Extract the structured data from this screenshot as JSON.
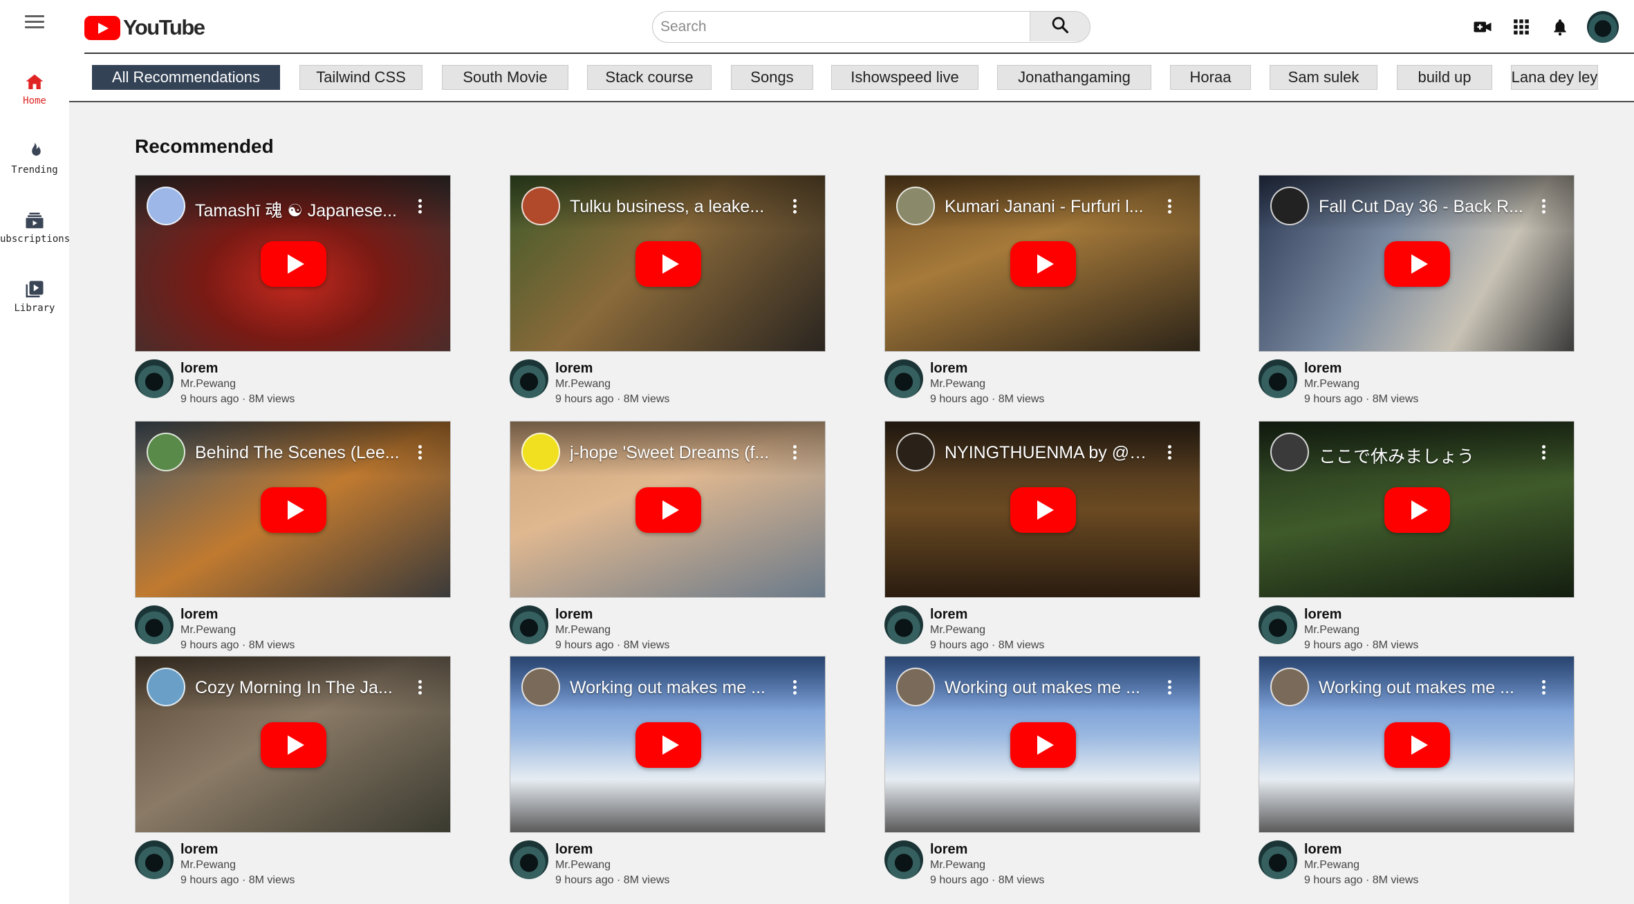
{
  "app": {
    "logo_text": "YouTube"
  },
  "search": {
    "placeholder": "Search",
    "value": ""
  },
  "sidebar": {
    "items": [
      {
        "label": "Home",
        "icon": "home-icon",
        "active": true
      },
      {
        "label": "Trending",
        "icon": "trending-icon",
        "active": false
      },
      {
        "label": "ubscriptions",
        "icon": "subscriptions-icon",
        "active": false
      },
      {
        "label": "Library",
        "icon": "library-icon",
        "active": false
      }
    ]
  },
  "chips": [
    "All Recommendations",
    "Tailwind CSS",
    "South Movie",
    "Stack course",
    "Songs",
    "Ishowspeed live",
    "Jonathangaming",
    "Horaa",
    "Sam sulek",
    "build up",
    "Lana dey ley"
  ],
  "main": {
    "section_title": "Recommended"
  },
  "videos": [
    {
      "overlay_title": "Tamashī 魂 ☯ Japanese...",
      "title": "lorem",
      "channel": "Mr.Pewang",
      "info": "9 hours ago · 8M views"
    },
    {
      "overlay_title": "Tulku business, a leake...",
      "title": "lorem",
      "channel": "Mr.Pewang",
      "info": "9 hours ago · 8M views"
    },
    {
      "overlay_title": "Kumari Janani - Furfuri l...",
      "title": "lorem",
      "channel": "Mr.Pewang",
      "info": "9 hours ago · 8M views"
    },
    {
      "overlay_title": "Fall Cut Day 36 - Back R...",
      "title": "lorem",
      "channel": "Mr.Pewang",
      "info": "9 hours ago · 8M views"
    },
    {
      "overlay_title": "Behind The Scenes (Lee...",
      "title": "lorem",
      "channel": "Mr.Pewang",
      "info": "9 hours ago · 8M views"
    },
    {
      "overlay_title": "j-hope 'Sweet Dreams (f...",
      "title": "lorem",
      "channel": "Mr.Pewang",
      "info": "9 hours ago · 8M views"
    },
    {
      "overlay_title": "NYINGTHUENMA by @S...",
      "title": "lorem",
      "channel": "Mr.Pewang",
      "info": "9 hours ago · 8M views"
    },
    {
      "overlay_title": "ここで休みましょう",
      "title": "lorem",
      "channel": "Mr.Pewang",
      "info": "9 hours ago · 8M views"
    },
    {
      "overlay_title": "Cozy Morning In The Ja...",
      "title": "lorem",
      "channel": "Mr.Pewang",
      "info": "9 hours ago · 8M views"
    },
    {
      "overlay_title": "Working out makes me ...",
      "title": "lorem",
      "channel": "Mr.Pewang",
      "info": "9 hours ago · 8M views"
    },
    {
      "overlay_title": "Working out makes me ...",
      "title": "lorem",
      "channel": "Mr.Pewang",
      "info": "9 hours ago · 8M views"
    },
    {
      "overlay_title": "Working out makes me ...",
      "title": "lorem",
      "channel": "Mr.Pewang",
      "info": "9 hours ago · 8M views"
    }
  ],
  "colors": {
    "brand_red": "#ff0000",
    "active_chip": "#334255",
    "background": "#f1f1f1"
  }
}
